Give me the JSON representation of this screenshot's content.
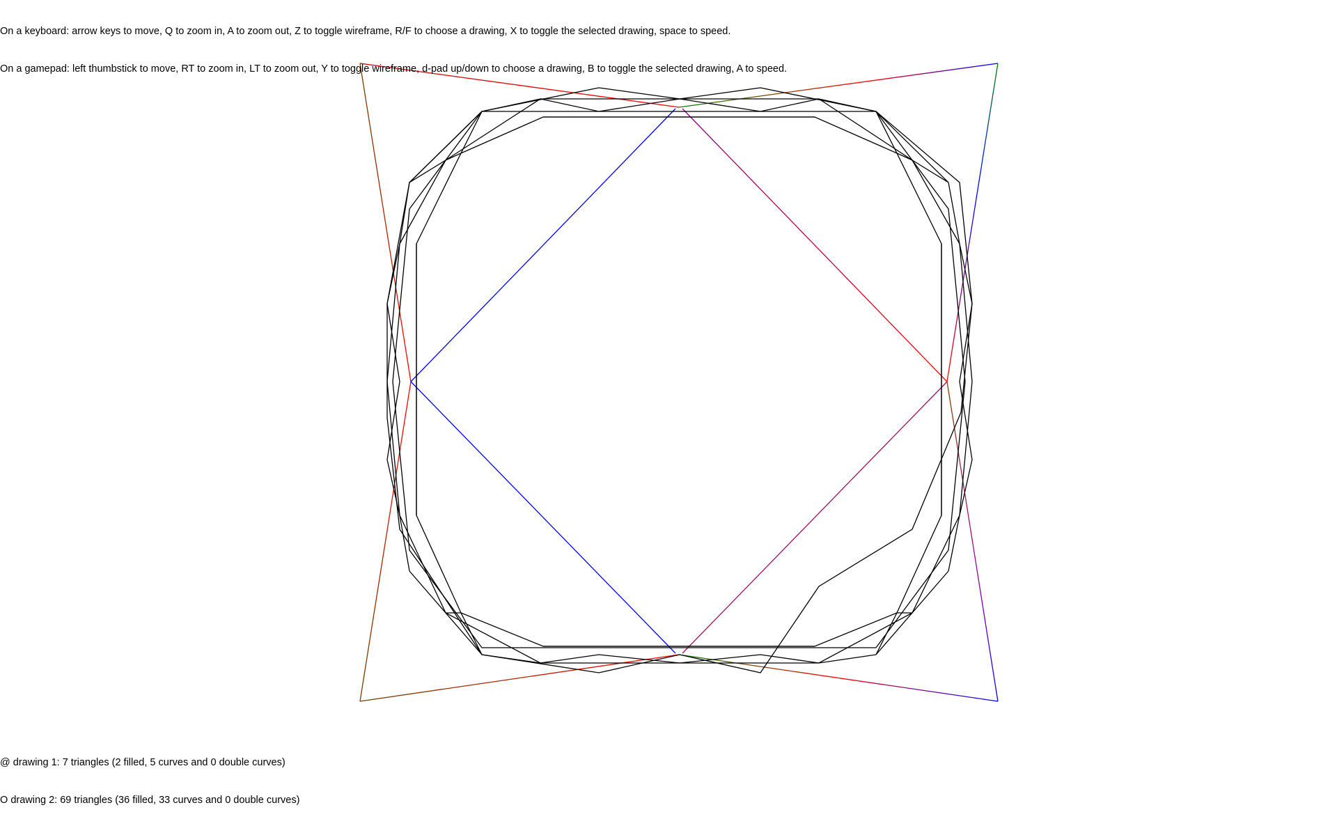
{
  "help": {
    "keyboard": "On a keyboard: arrow keys to move, Q to zoom in, A to zoom out, Z to toggle wireframe, R/F to choose a drawing, X to toggle the selected drawing, space to speed.",
    "gamepad": "On a gamepad: left thumbstick to move, RT to zoom in, LT to zoom out, Y to toggle wireframe, d-pad up/down to choose a drawing, B to toggle the selected drawing, A to speed."
  },
  "drawings": [
    {
      "marker": "@",
      "label": "drawing 1: 7 triangles (2 filled, 5 curves and 0 double curves)"
    },
    {
      "marker": "O",
      "label": "drawing 2: 69 triangles (36 filled, 33 curves and 0 double curves)"
    }
  ],
  "colors": {
    "red": "#ff0000",
    "green": "#008000",
    "blue": "#0000ff",
    "wire": "#000000",
    "background": "#ffffff"
  }
}
